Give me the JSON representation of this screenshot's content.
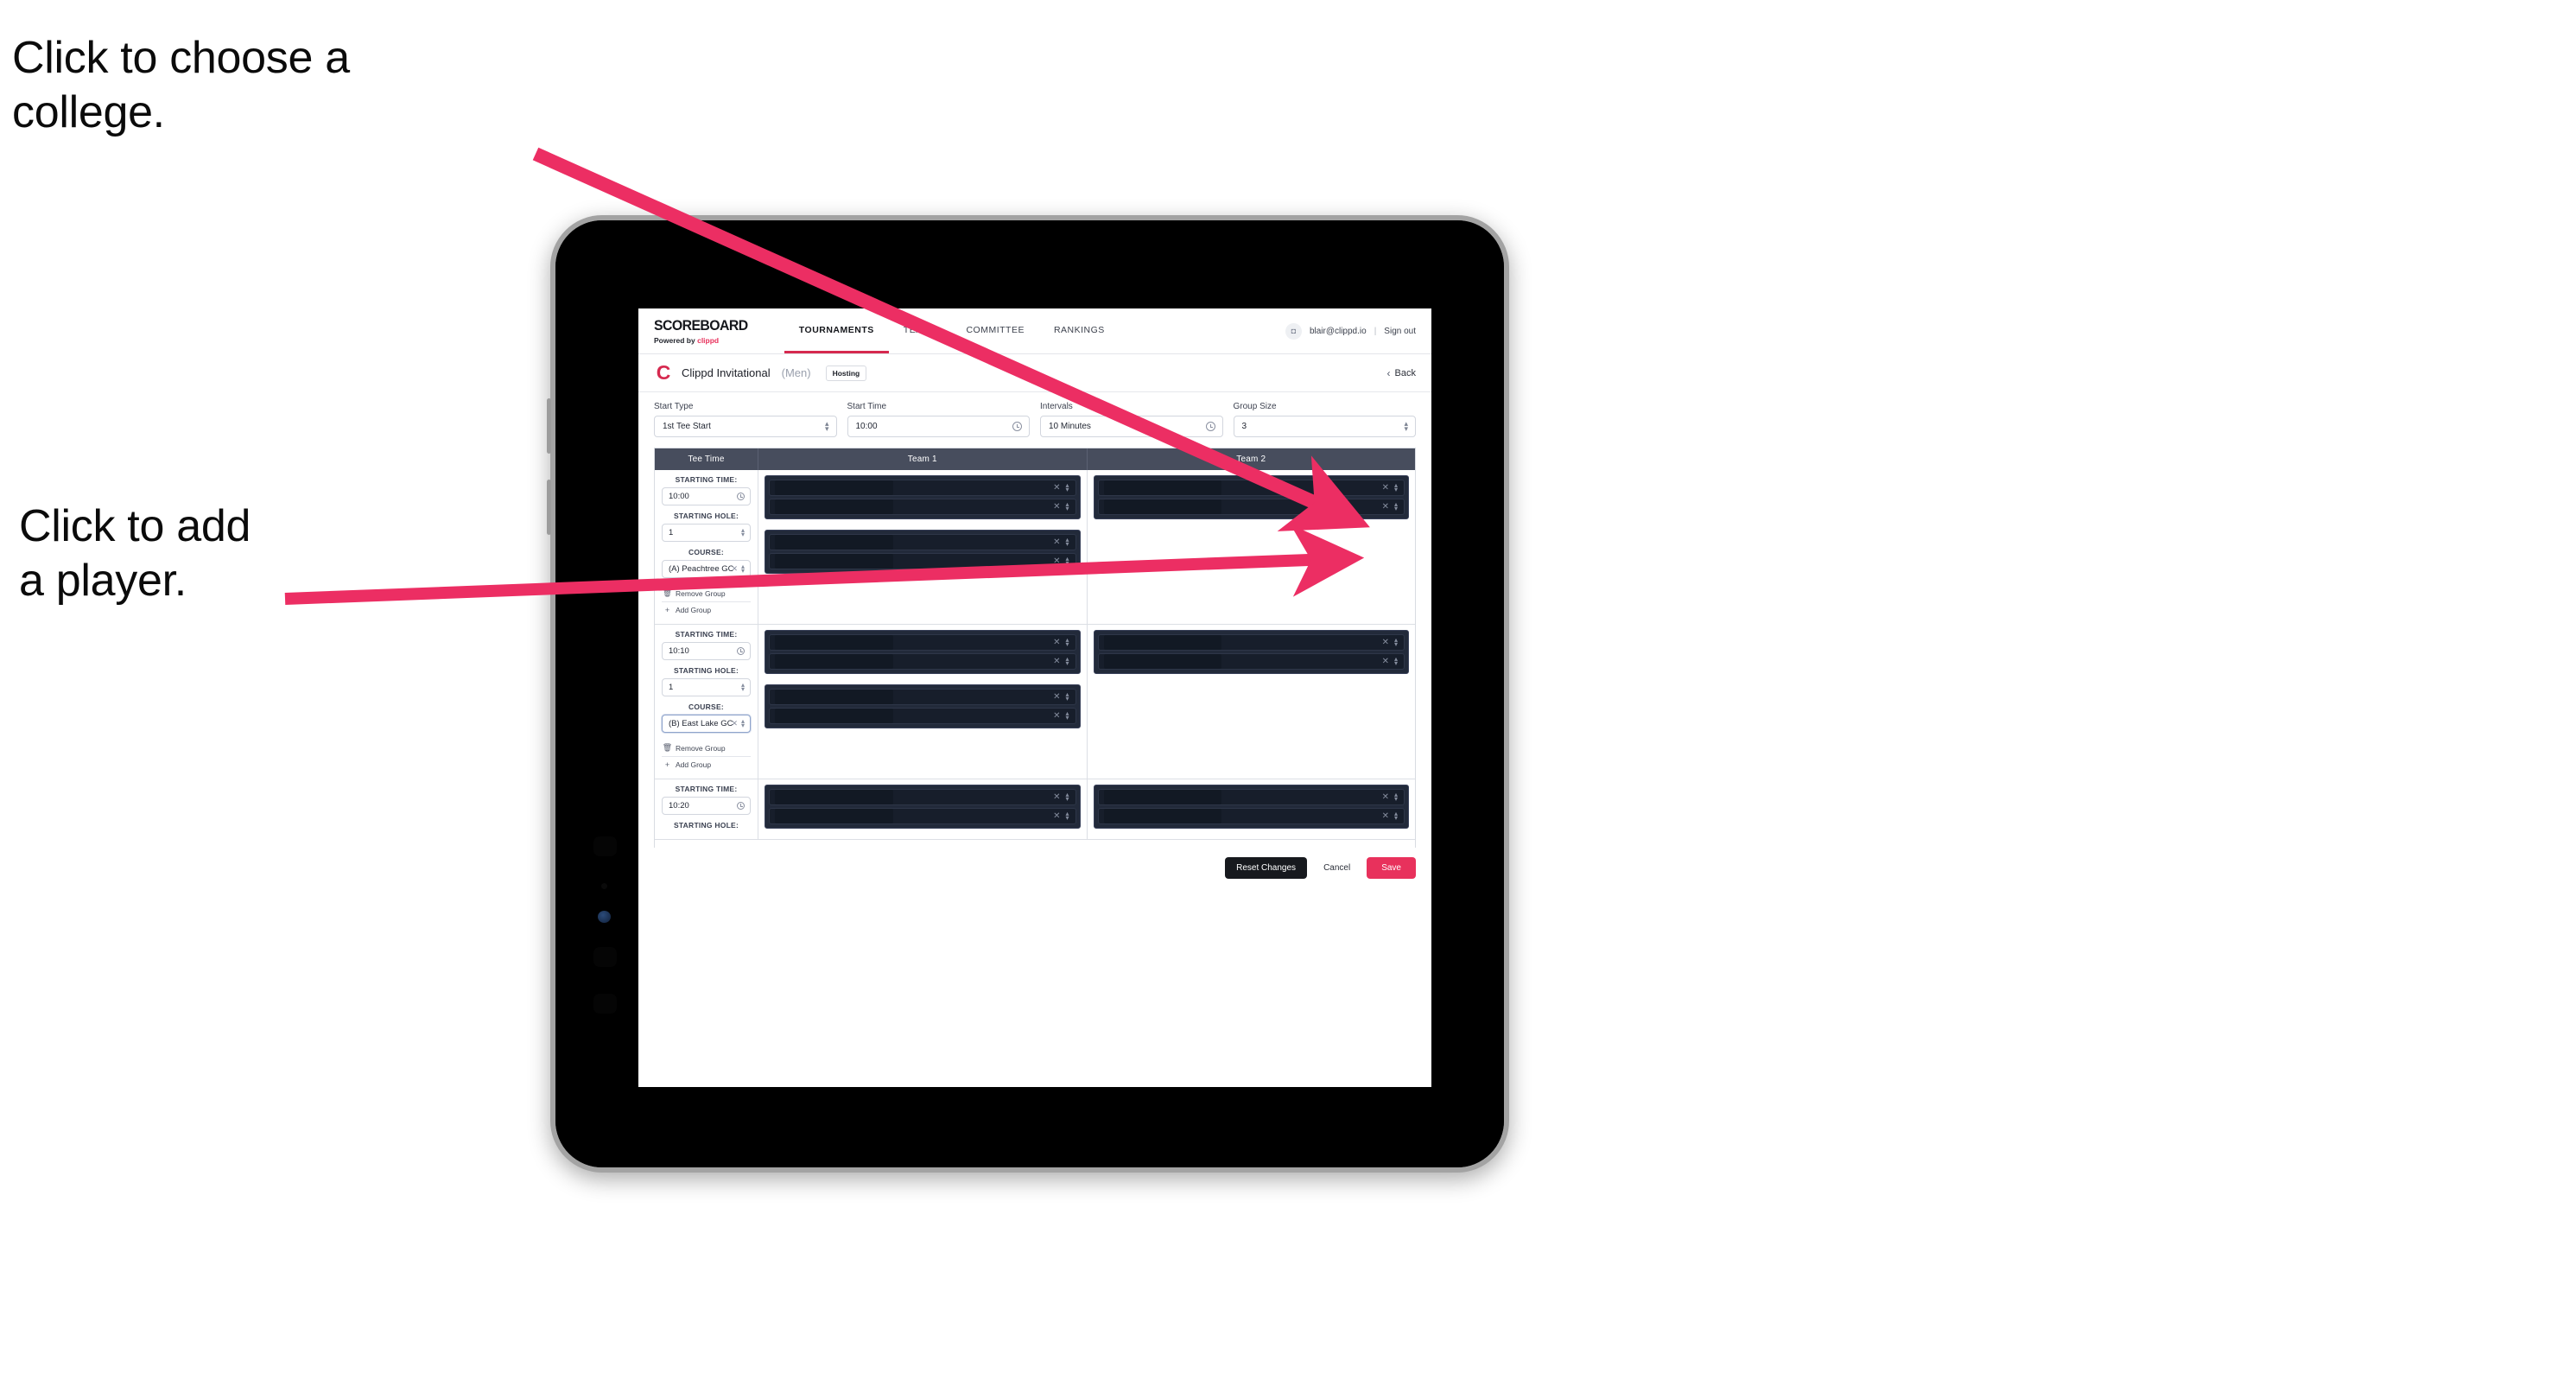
{
  "annotations": {
    "college": "Click to choose a\ncollege.",
    "player": "Click to add\na player."
  },
  "colors": {
    "accent_pink": "#e8315c",
    "nav_active_underline": "#d6294f",
    "table_header_bg": "#474d5d",
    "player_group_bg": "#222a3a",
    "reset_button_bg": "#17191e"
  },
  "topnav": {
    "brand_title": "SCOREBOARD",
    "brand_sub_prefix": "Powered by",
    "brand_sub_name": "clippd",
    "links": [
      {
        "label": "TOURNAMENTS",
        "active": true
      },
      {
        "label": "TEAMS",
        "active": false
      },
      {
        "label": "COMMITTEE",
        "active": false
      },
      {
        "label": "RANKINGS",
        "active": false
      }
    ],
    "avatar_glyph": "◘",
    "email": "blair@clippd.io",
    "separator": "|",
    "sign_out": "Sign out"
  },
  "eventbar": {
    "logo_letter": "C",
    "name": "Clippd Invitational",
    "gender": "(Men)",
    "badge": "Hosting",
    "back_chevron": "‹",
    "back_label": "Back"
  },
  "settings": {
    "fields": [
      {
        "label": "Start Type",
        "value": "1st Tee Start",
        "icon": "spinner"
      },
      {
        "label": "Start Time",
        "value": "10:00",
        "icon": "clock"
      },
      {
        "label": "Intervals",
        "value": "10 Minutes",
        "icon": "clock"
      },
      {
        "label": "Group Size",
        "value": "3",
        "icon": "spinner"
      }
    ]
  },
  "table": {
    "headers": [
      "Tee Time",
      "Team 1",
      "Team 2"
    ],
    "labels": {
      "starting_time": "STARTING TIME:",
      "starting_hole": "STARTING HOLE:",
      "course": "COURSE:",
      "remove_group": "Remove Group",
      "add_group": "Add Group",
      "remove_icon": "🗑",
      "add_icon": "+",
      "clear_icon": "✕",
      "slot_clear_icon": "✕"
    },
    "rows": [
      {
        "starting_time": "10:00",
        "starting_hole": "1",
        "course": "(A) Peachtree GC",
        "course_focused": false,
        "team1_groups": [
          {
            "slots": [
              "",
              ""
            ]
          },
          {
            "slots": [
              "",
              ""
            ]
          }
        ],
        "team2_groups": [
          {
            "slots": [
              "",
              ""
            ]
          }
        ]
      },
      {
        "starting_time": "10:10",
        "starting_hole": "1",
        "course": "(B) East Lake GC",
        "course_focused": true,
        "team1_groups": [
          {
            "slots": [
              "",
              ""
            ]
          },
          {
            "slots": [
              "",
              ""
            ]
          }
        ],
        "team2_groups": [
          {
            "slots": [
              "",
              ""
            ]
          }
        ]
      },
      {
        "starting_time": "10:20",
        "starting_hole": "",
        "course": "",
        "course_focused": false,
        "team1_groups": [
          {
            "slots": [
              "",
              ""
            ]
          }
        ],
        "team2_groups": [
          {
            "slots": [
              "",
              ""
            ]
          }
        ]
      }
    ]
  },
  "footer": {
    "reset": "Reset Changes",
    "cancel": "Cancel",
    "save": "Save"
  }
}
